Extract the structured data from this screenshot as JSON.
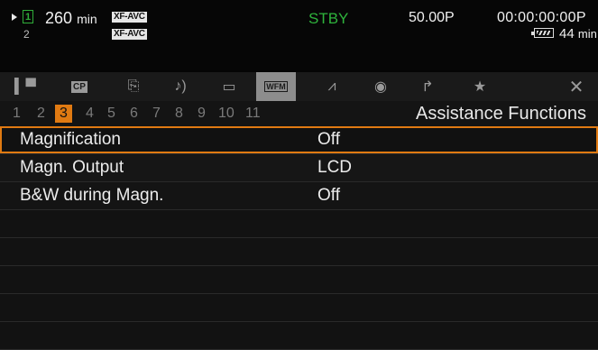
{
  "status": {
    "remaining_value": "260",
    "remaining_unit": "min",
    "format_1": "XF-AVC",
    "format_2": "XF-AVC",
    "slot_1": "1",
    "slot_2": "2",
    "mode": "STBY",
    "frame_rate": "50.00P",
    "timecode": "00:00:00:00P",
    "battery_value": "44",
    "battery_unit": "min",
    "colors": {
      "standby": "#2eb33c",
      "accent": "#e07a12"
    }
  },
  "tabs": [
    {
      "icon": "camera-icon",
      "glyph": "▝▀▜"
    },
    {
      "icon": "custom-picture-icon",
      "glyph": "CP"
    },
    {
      "icon": "system-settings-icon",
      "glyph": "⎘"
    },
    {
      "icon": "audio-icon",
      "glyph": "♪"
    },
    {
      "icon": "video-setup-icon",
      "glyph": "▭"
    },
    {
      "icon": "lcd-assist-icon",
      "glyph": "WFM"
    },
    {
      "icon": "tc-icon",
      "glyph": "⩘"
    },
    {
      "icon": "recording-media-icon",
      "glyph": "◉"
    },
    {
      "icon": "wrench-icon",
      "glyph": "⚲"
    },
    {
      "icon": "star-icon",
      "glyph": "★"
    },
    {
      "icon": "close-icon",
      "glyph": "✕"
    }
  ],
  "pages": [
    "1",
    "2",
    "3",
    "4",
    "5",
    "6",
    "7",
    "8",
    "9",
    "10",
    "11"
  ],
  "active_page": "3",
  "menu": {
    "title": "Assistance Functions",
    "items": [
      {
        "label": "Magnification",
        "value": "Off"
      },
      {
        "label": "Magn. Output",
        "value": "LCD"
      },
      {
        "label": "B&W during Magn.",
        "value": "Off"
      }
    ]
  }
}
